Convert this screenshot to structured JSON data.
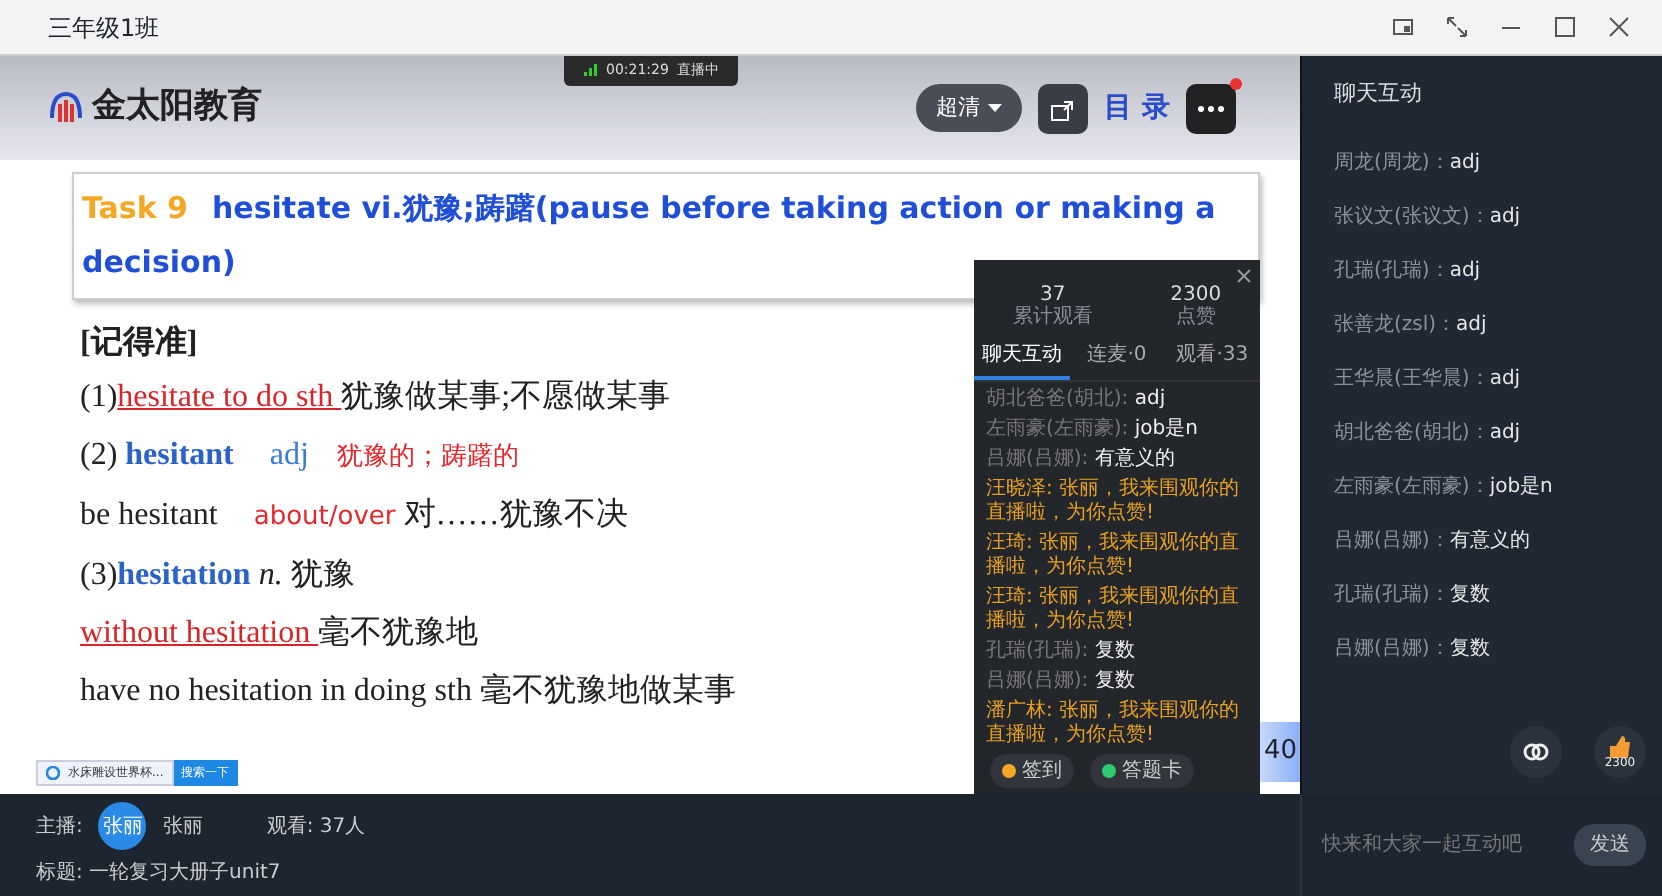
{
  "window": {
    "title": "三年级1班"
  },
  "live_status": {
    "time": "00:21:29",
    "label": "直播中"
  },
  "logo": {
    "text": "金太阳教育"
  },
  "slide_controls": {
    "quality": "超清",
    "toc": "目 录",
    "notification": true
  },
  "slide": {
    "task_label": "Task 9",
    "heading": "hesitate vi.犹豫;踌躇(pause before taking action or making a decision)",
    "section": "[记得准]",
    "lines": [
      [
        {
          "kind": "plain",
          "text": "(1)"
        },
        {
          "kind": "red-underline",
          "text": "hesitate to do sth "
        },
        {
          "kind": "plain",
          "text": "犹豫做某事;不愿做某事"
        }
      ],
      [
        {
          "kind": "plain",
          "text": "(2) "
        },
        {
          "kind": "blue-bold",
          "text": "hesitant"
        },
        {
          "kind": "blue",
          "text": "adj"
        },
        {
          "kind": "red",
          "text": "犹豫的；踌躇的"
        }
      ],
      [
        {
          "kind": "plain",
          "text": "be hesitant "
        },
        {
          "kind": "red",
          "text": "about/over"
        },
        {
          "kind": "plain",
          "text": " 对……犹豫不决"
        }
      ],
      [
        {
          "kind": "plain",
          "text": "(3)"
        },
        {
          "kind": "blue-bold",
          "text": "hesitation"
        },
        {
          "kind": "italic",
          "text": " n."
        },
        {
          "kind": "plain",
          "text": " 犹豫"
        }
      ],
      [
        {
          "kind": "red-underline",
          "text": "without hesitation "
        },
        {
          "kind": "plain",
          "text": "毫不犹豫地"
        }
      ],
      [
        {
          "kind": "plain",
          "text": "have no hesitation in doing sth 毫不犹豫地做某事"
        }
      ]
    ]
  },
  "taskbar": {
    "tab": "水床雕设世界杯...",
    "button": "搜索一下"
  },
  "page_badge": "40",
  "overlay_panel": {
    "stats": [
      {
        "value": "37",
        "label": "累计观看"
      },
      {
        "value": "2300",
        "label": "点赞"
      }
    ],
    "tabs": [
      {
        "label": "聊天互动",
        "selected": true
      },
      {
        "label": "连麦·0",
        "selected": false
      },
      {
        "label": "观看·33",
        "selected": false
      }
    ],
    "messages": [
      {
        "kind": "chat",
        "sender": "胡北爸爸(胡北):",
        "text": "adj"
      },
      {
        "kind": "chat",
        "sender": "左雨豪(左雨豪):",
        "text": "job是n"
      },
      {
        "kind": "chat",
        "sender": "吕娜(吕娜):",
        "text": "有意义的"
      },
      {
        "kind": "notice",
        "text": "汪晓泽: 张丽，我来围观你的直播啦，为你点赞!"
      },
      {
        "kind": "notice",
        "text": "汪琦: 张丽，我来围观你的直播啦，为你点赞!"
      },
      {
        "kind": "notice",
        "text": "汪琦: 张丽，我来围观你的直播啦，为你点赞!"
      },
      {
        "kind": "chat",
        "sender": "孔瑞(孔瑞):",
        "text": "复数"
      },
      {
        "kind": "chat",
        "sender": "吕娜(吕娜):",
        "text": "复数"
      },
      {
        "kind": "notice",
        "text": "潘广林: 张丽，我来围观你的直播啦，为你点赞!"
      }
    ],
    "buttons": [
      {
        "label": "签到",
        "color": "#f5a623"
      },
      {
        "label": "答题卡",
        "color": "#2ecc71"
      }
    ]
  },
  "chat": {
    "title": "聊天互动",
    "messages": [
      {
        "sender": "周龙(周龙)：",
        "text": "adj"
      },
      {
        "sender": "张议文(张议文)：",
        "text": "adj"
      },
      {
        "sender": "孔瑞(孔瑞)：",
        "text": "adj"
      },
      {
        "sender": "张善龙(zsl)：",
        "text": "adj"
      },
      {
        "sender": "王华晨(王华晨)：",
        "text": "adj"
      },
      {
        "sender": "胡北爸爸(胡北)：",
        "text": "adj"
      },
      {
        "sender": "左雨豪(左雨豪)：",
        "text": "job是n"
      },
      {
        "sender": "吕娜(吕娜)：",
        "text": "有意义的"
      },
      {
        "sender": "孔瑞(孔瑞)：",
        "text": "复数"
      },
      {
        "sender": "吕娜(吕娜)：",
        "text": "复数"
      }
    ],
    "like_count": "2300",
    "input_placeholder": "快来和大家一起互动吧",
    "send": "发送"
  },
  "footer": {
    "host_label": "主播:",
    "avatar_text": "张丽",
    "host_name": "张丽",
    "viewers": "观看: 37人",
    "title": "标题: 一轮复习大册子unit7"
  }
}
